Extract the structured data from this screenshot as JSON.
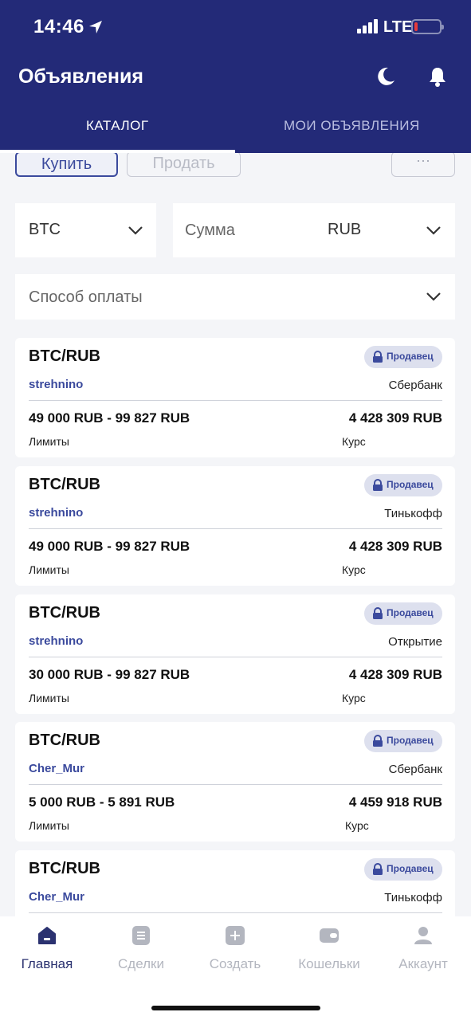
{
  "status_bar": {
    "time": "14:46",
    "network": "LTE"
  },
  "header": {
    "title": "Объявления",
    "tabs": [
      {
        "label": "КАТАЛОГ"
      },
      {
        "label": "МОИ ОБЪЯВЛЕНИЯ"
      }
    ]
  },
  "trade_buttons": {
    "buy": "Купить",
    "sell": "Продать",
    "more": "···"
  },
  "filters": {
    "coin": "BTC",
    "amount_placeholder": "Сумма",
    "currency": "RUB",
    "payment_placeholder": "Способ оплаты"
  },
  "listings": [
    {
      "pair": "BTC/RUB",
      "badge": "Продавец",
      "trader": "strehnino",
      "bank": "Сбербанк",
      "limits": "49 000 RUB - 99 827 RUB",
      "rate": "4 428 309 RUB",
      "limits_label": "Лимиты",
      "rate_label": "Курс"
    },
    {
      "pair": "BTC/RUB",
      "badge": "Продавец",
      "trader": "strehnino",
      "bank": "Тинькофф",
      "limits": "49 000 RUB - 99 827 RUB",
      "rate": "4 428 309 RUB",
      "limits_label": "Лимиты",
      "rate_label": "Курс"
    },
    {
      "pair": "BTC/RUB",
      "badge": "Продавец",
      "trader": "strehnino",
      "bank": "Открытие",
      "limits": "30 000 RUB - 99 827 RUB",
      "rate": "4 428 309 RUB",
      "limits_label": "Лимиты",
      "rate_label": "Курс"
    },
    {
      "pair": "BTC/RUB",
      "badge": "Продавец",
      "trader": "Cher_Mur",
      "bank": "Сбербанк",
      "limits": "5 000 RUB - 5 891 RUB",
      "rate": "4 459 918 RUB",
      "limits_label": "Лимиты",
      "rate_label": "Курс"
    },
    {
      "pair": "BTC/RUB",
      "badge": "Продавец",
      "trader": "Cher_Mur",
      "bank": "Тинькофф"
    }
  ],
  "bottom_nav": [
    {
      "label": "Главная",
      "icon": "home-icon",
      "active": true
    },
    {
      "label": "Сделки",
      "icon": "deals-icon",
      "active": false
    },
    {
      "label": "Создать",
      "icon": "create-icon",
      "active": false
    },
    {
      "label": "Кошельки",
      "icon": "wallet-icon",
      "active": false
    },
    {
      "label": "Аккаунт",
      "icon": "account-icon",
      "active": false
    }
  ],
  "colors": {
    "header_bg": "#232a78",
    "accent": "#3b4a9d",
    "page_bg": "#f4f5f8",
    "nav_active": "#2b3270",
    "nav_inactive": "#b3b6bf"
  }
}
